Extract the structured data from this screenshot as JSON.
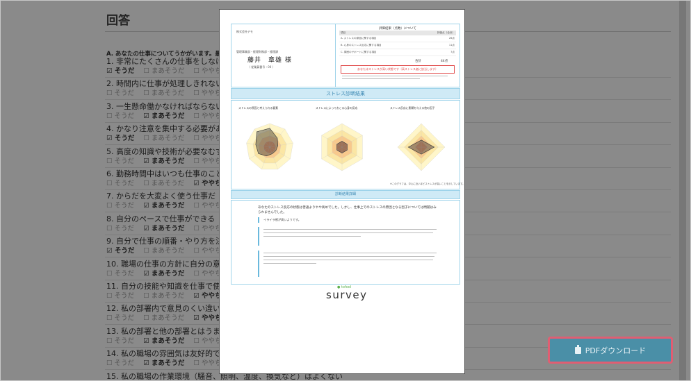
{
  "page": {
    "title": "回答",
    "section_label": "A. あなたの仕事についてうかがいます。最もあ",
    "options": [
      "そうだ",
      "まあそうだ",
      "ややち"
    ],
    "questions": [
      {
        "text": "1. 非常にたくさんの仕事をしなけれ",
        "selected": 0
      },
      {
        "text": "2. 時間内に仕事が処理しきれない",
        "selected": -1
      },
      {
        "text": "3. 一生懸命働かなければならない",
        "selected": 1
      },
      {
        "text": "4. かなり注意を集中する必要がある",
        "selected": 0
      },
      {
        "text": "5. 高度の知識や技術が必要なむずか",
        "selected": 1
      },
      {
        "text": "6. 勤務時間中はいつも仕事のことを",
        "selected": 2
      },
      {
        "text": "7. からだを大変よく使う仕事だ",
        "selected": 1
      },
      {
        "text": "8. 自分のペースで仕事ができる",
        "selected": 1
      },
      {
        "text": "9. 自分で仕事の順番・やり方を決め",
        "selected": 0
      },
      {
        "text": "10. 職場の仕事の方針に自分の意見を",
        "selected": 1
      },
      {
        "text": "11. 自分の技能や知識を仕事で使うこ",
        "selected": 2
      },
      {
        "text": "12. 私の部署内で意見のくい違いがあ",
        "selected": 2
      },
      {
        "text": "13. 私の部署と他の部署とはうまが合",
        "selected": 1
      },
      {
        "text": "14. 私の職場の雰囲気は友好的である",
        "selected": 1
      },
      {
        "text": "15. 私の職場の作業環境（騒音、照明、温度、換気など）はよくない",
        "selected": -1
      }
    ]
  },
  "report": {
    "company": "株式会社デモ",
    "department": "管理事業部・経理財務部・経理課",
    "employee_name": "藤井　章雄 様",
    "employee_no": "（ 従業員番号 : 00 ）",
    "eval_title": "評価結果（点数）について",
    "eval_headers": [
      "項目",
      "評価点（合計）"
    ],
    "eval_rows": [
      {
        "label": "A. ストレスの原因に関する項目",
        "value": "26点"
      },
      {
        "label": "B. 心身のストレス反応に関する項目",
        "value": "11点"
      },
      {
        "label": "C. 周囲のサポートに関する項目",
        "value": "7点"
      }
    ],
    "total_label": "合計",
    "total_value": "44点",
    "warning": "あなたはストレスが高い状態です（高ストレス者に該当します）",
    "diagnosis_header": "ストレス診断結果",
    "chart_titles": [
      "ストレスの原因と考えられる要素",
      "ストレスによっておこる心身の反応",
      "ストレス反応に影響を与える他の因子"
    ],
    "chart_note": "※このグラフは、中心に近いほどストレスが高いことを示しています。",
    "detail_header": "診断結果詳細",
    "detail_intro": "あなたのストレス反応の状態は普通よりやや高めでした。しかし、仕事上でのストレスの原因となる因子については問題はみられませんでした。",
    "detail_point": "イライラ感が高いようです。",
    "logo_small": "● tofool",
    "logo_big": "survey"
  },
  "download_button": {
    "label": "PDFダウンロード",
    "icon": "file-icon"
  },
  "colors": {
    "accent": "#4a8fa7",
    "highlight_border": "#e05e72",
    "warning": "#e04848",
    "section_bar": "#cfeaf6"
  }
}
